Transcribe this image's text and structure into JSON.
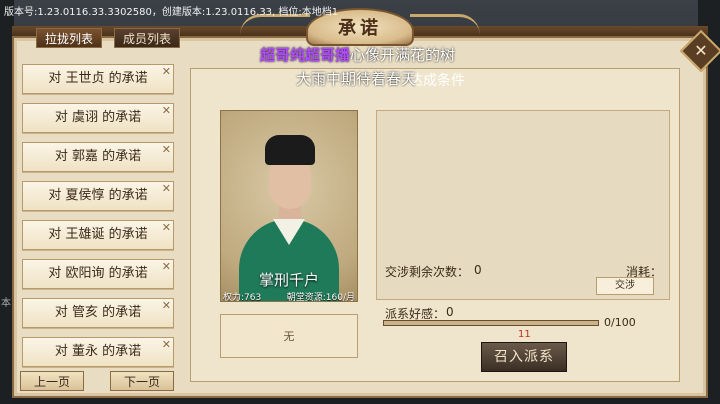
{
  "version_line": "版本号:1.23.0116.33.3302580，创建版本:1.23.0116.33, 档位:本地档1",
  "title": "承诺",
  "tabs": [
    {
      "label": "拉拢列表",
      "active": true
    },
    {
      "label": "成员列表",
      "active": false
    }
  ],
  "close_icon": "close-x-icon",
  "promise_list": [
    {
      "label": "对 王世贞 的承诺"
    },
    {
      "label": "对 虞诩 的承诺"
    },
    {
      "label": "对 郭嘉 的承诺"
    },
    {
      "label": "对 夏侯惇 的承诺"
    },
    {
      "label": "对 王雄诞 的承诺"
    },
    {
      "label": "对 欧阳询 的承诺"
    },
    {
      "label": "对 管亥 的承诺"
    },
    {
      "label": "对 董永 的承诺"
    }
  ],
  "item_close_glyph": "✕",
  "pager": {
    "prev": "上一页",
    "next": "下一页"
  },
  "section_title": "达成条件",
  "portrait": {
    "name": "掌刑千户",
    "power": "权力:763",
    "resource": "朝堂资源:160/月"
  },
  "none_text": "无",
  "negotiate": {
    "label": "交涉剩余次数：",
    "value": "0",
    "cost_label": "消耗：",
    "button": "交涉"
  },
  "favor": {
    "label": "派系好感：",
    "value": "0",
    "progress_text": "0/100",
    "progress_fraction": 0,
    "red_number": "11"
  },
  "summon_button": "召入派系",
  "overlay": {
    "highlight": "超哥纯超哥播",
    "line1_rest": "心像开满花的树",
    "line2": "大雨中期待着春天"
  },
  "side_char": "本",
  "colors": {
    "parchment": "#e8dcc2",
    "frame_brown": "#8a6a43",
    "robe_green": "#1f7a5a",
    "highlight_purple": "#b04bff",
    "red_number": "#c0301a"
  }
}
